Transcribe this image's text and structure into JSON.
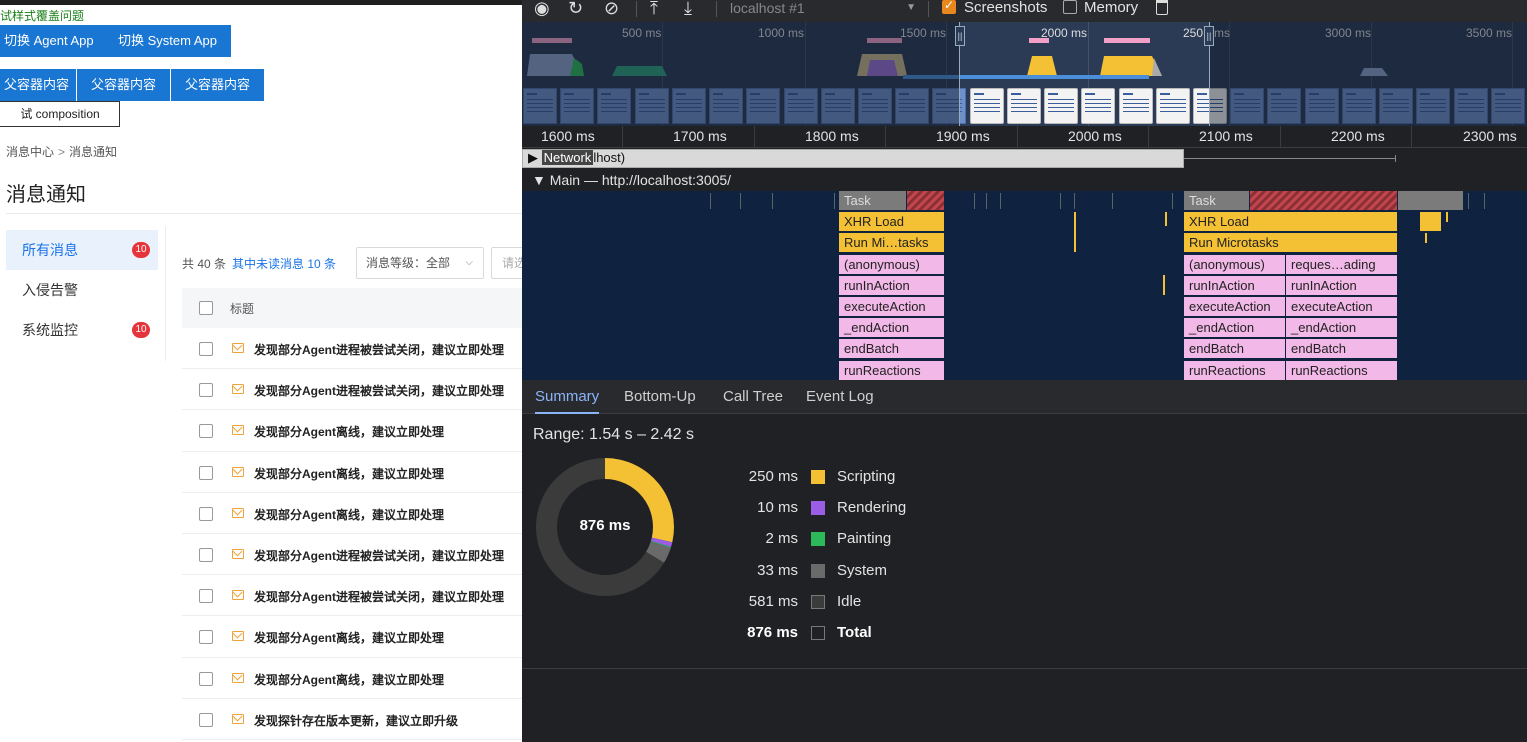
{
  "app": {
    "test_title": "试样式覆盖问题",
    "switch_buttons": [
      "切换 Agent App",
      "切换 System App"
    ],
    "parent_buttons": [
      "父容器内容",
      "父容器内容",
      "父容器内容"
    ],
    "composition_button": "试 composition",
    "breadcrumb": [
      "消息中心",
      "消息通知"
    ],
    "breadcrumb_sep": ">",
    "page_title": "消息通知",
    "sidebar": [
      {
        "label": "所有消息",
        "badge": "10",
        "active": true
      },
      {
        "label": "入侵告警",
        "badge": "",
        "active": false
      },
      {
        "label": "系统监控",
        "badge": "10",
        "active": false
      }
    ],
    "filter": {
      "total_text": "共 40 条",
      "unread_text": "其中未读消息 10 条",
      "level_select": "消息等级：全部",
      "search_placeholder": "请选择"
    },
    "table": {
      "header": "标题",
      "rows": [
        "发现部分Agent进程被尝试关闭，建议立即处理",
        "发现部分Agent进程被尝试关闭，建议立即处理",
        "发现部分Agent离线，建议立即处理",
        "发现部分Agent离线，建议立即处理",
        "发现部分Agent离线，建议立即处理",
        "发现部分Agent进程被尝试关闭，建议立即处理",
        "发现部分Agent进程被尝试关闭，建议立即处理",
        "发现部分Agent离线，建议立即处理",
        "发现部分Agent离线，建议立即处理",
        "发现探针存在版本更新，建议立即升级"
      ]
    }
  },
  "devtools": {
    "toolbar": {
      "target": "localhost #1",
      "screenshots_label": "Screenshots",
      "screenshots_checked": true,
      "memory_label": "Memory",
      "memory_checked": false
    },
    "overview_ticks": [
      "500 ms",
      "1000 ms",
      "1500 ms",
      "2000 ms",
      "250",
      "ms",
      "3000 ms",
      "3500 ms"
    ],
    "ruler_ticks": [
      "1600 ms",
      "1700 ms",
      "1800 ms",
      "1900 ms",
      "2000 ms",
      "2100 ms",
      "2200 ms",
      "2300 ms"
    ],
    "network_label": "Network",
    "network_suffix": "lhost)",
    "main_label": "Main — http://localhost:3005/",
    "flame_left": [
      "Task",
      "XHR Load",
      "Run Mi…tasks",
      "(anonymous)",
      "runInAction",
      "executeAction",
      "_endAction",
      "endBatch",
      "runReactions"
    ],
    "flame_right_a": [
      "Task",
      "XHR Load",
      "Run Microtasks",
      "(anonymous)",
      "runInAction",
      "executeAction",
      "_endAction",
      "endBatch",
      "runReactions"
    ],
    "flame_right_b": [
      "reques…ading",
      "runInAction",
      "executeAction",
      "_endAction",
      "endBatch",
      "runReactions"
    ],
    "tabs": [
      "Summary",
      "Bottom-Up",
      "Call Tree",
      "Event Log"
    ],
    "active_tab": "Summary",
    "range": "Range: 1.54 s – 2.42 s",
    "summary": {
      "total_label": "876 ms",
      "items": [
        {
          "value": "250 ms",
          "name": "Scripting",
          "ms": 250,
          "color": "#f4c034"
        },
        {
          "value": "10 ms",
          "name": "Rendering",
          "ms": 10,
          "color": "#9b5de5"
        },
        {
          "value": "2 ms",
          "name": "Painting",
          "ms": 2,
          "color": "#2db85a"
        },
        {
          "value": "33 ms",
          "name": "System",
          "ms": 33,
          "color": "#6a6a6a"
        },
        {
          "value": "581 ms",
          "name": "Idle",
          "ms": 581,
          "color": "#3b3b3b"
        },
        {
          "value": "876 ms",
          "name": "Total",
          "ms": 876,
          "color": "#202124"
        }
      ]
    }
  }
}
